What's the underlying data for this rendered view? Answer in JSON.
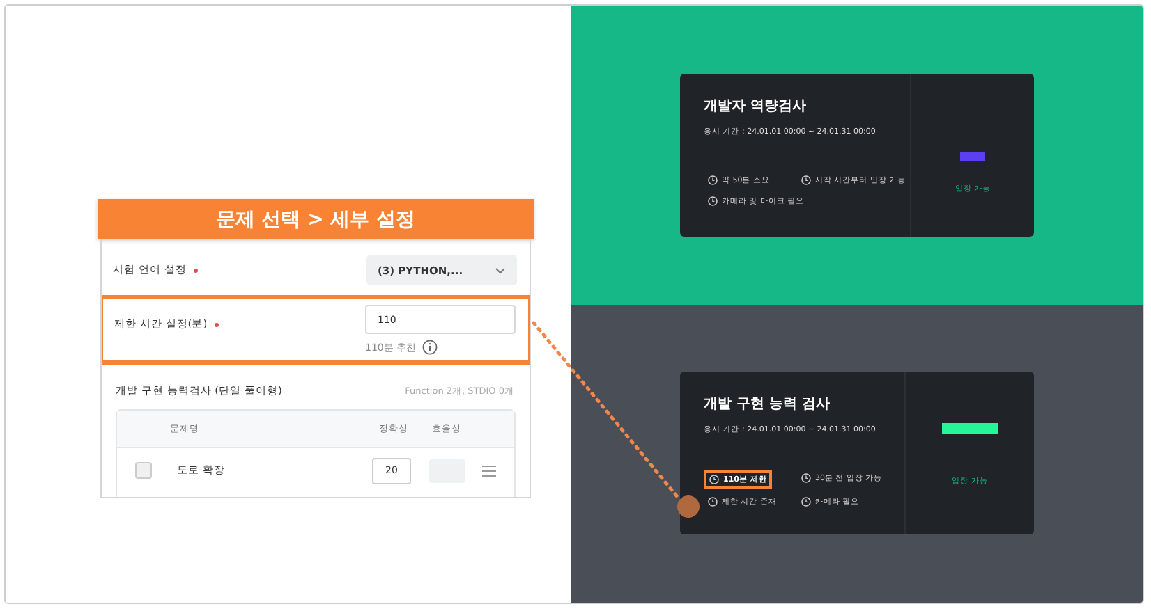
{
  "settings_panel": {
    "banner": "문제 선택 > 세부 설정",
    "language": {
      "label": "시험 언어 설정",
      "required": true,
      "value": "(3) PYTHON,..."
    },
    "time_limit": {
      "label": "제한 시간 설정(분)",
      "required": true,
      "value": "110",
      "hint": "110분 추천",
      "highlighted": true
    },
    "section": {
      "title": "개발 구현 능력검사 (단일 풀이형)",
      "summary": "Function 2개, STDIO 0개"
    },
    "table": {
      "columns": [
        "문제명",
        "정확성",
        "효율성"
      ],
      "rows": [
        {
          "name": "도로 확장",
          "accuracy": "20"
        }
      ]
    }
  },
  "cards": [
    {
      "title": "개발자 역량검사",
      "period": "응시 기간 : 24.01.01 00:00 ~ 24.01.31 00:00",
      "color": "#5b3ff0",
      "status": "입장 가능",
      "infos": [
        {
          "text": "약 50분 소요",
          "highlighted": false
        },
        {
          "text": "시작 시간부터 입장 가능",
          "highlighted": false
        },
        {
          "text": "카메라 및 마이크 필요",
          "highlighted": false
        }
      ]
    },
    {
      "title": "개발 구현 능력 검사",
      "period": "응시 기간 : 24.01.01 00:00 ~ 24.01.31 00:00",
      "color": "#27f59a",
      "status": "입장 가능",
      "infos": [
        {
          "text": "110분 제한",
          "highlighted": true
        },
        {
          "text": "30분 전 입장 가능",
          "highlighted": false
        },
        {
          "text": "제한 시간 존재",
          "highlighted": false
        },
        {
          "text": "카메라 필요",
          "highlighted": false
        }
      ]
    }
  ]
}
